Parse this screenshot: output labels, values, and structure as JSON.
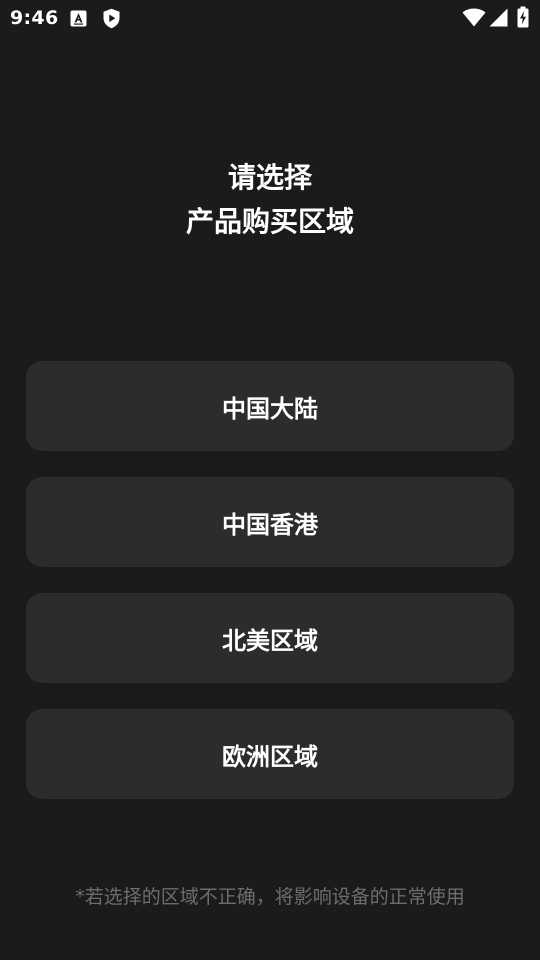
{
  "status_bar": {
    "time": "9:46",
    "icons": [
      "font-a-icon",
      "shield-play-icon",
      "wifi-icon",
      "cellular-signal-icon",
      "battery-charging-icon"
    ]
  },
  "title": {
    "line1": "请选择",
    "line2": "产品购买区域"
  },
  "regions": [
    {
      "label": "中国大陆"
    },
    {
      "label": "中国香港"
    },
    {
      "label": "北美区域"
    },
    {
      "label": "欧洲区域"
    }
  ],
  "footer_note": "*若选择的区域不正确，将影响设备的正常使用",
  "colors": {
    "background": "#1b1b1d",
    "button": "#2c2c2f",
    "text": "#ffffff",
    "muted_text": "#6d6d70"
  }
}
